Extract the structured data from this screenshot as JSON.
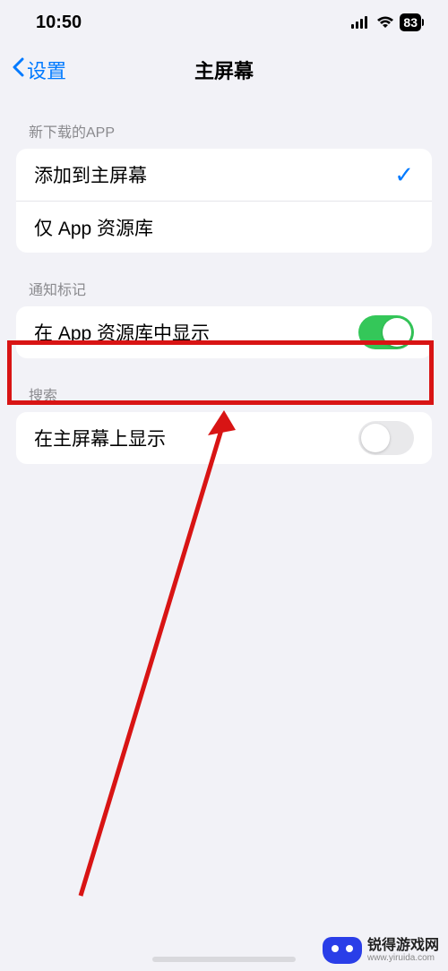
{
  "status": {
    "time": "10:50",
    "battery": "83"
  },
  "nav": {
    "back_label": "设置",
    "title": "主屏幕"
  },
  "sections": {
    "new_apps": {
      "header": "新下载的APP",
      "add_to_home": "添加到主屏幕",
      "app_library_only": "仅 App 资源库"
    },
    "badges": {
      "header": "通知标记",
      "show_in_library": "在 App 资源库中显示"
    },
    "search": {
      "header": "搜索",
      "show_on_home": "在主屏幕上显示"
    }
  },
  "watermark": {
    "name": "锐得游戏网",
    "url": "www.yiruida.com"
  }
}
